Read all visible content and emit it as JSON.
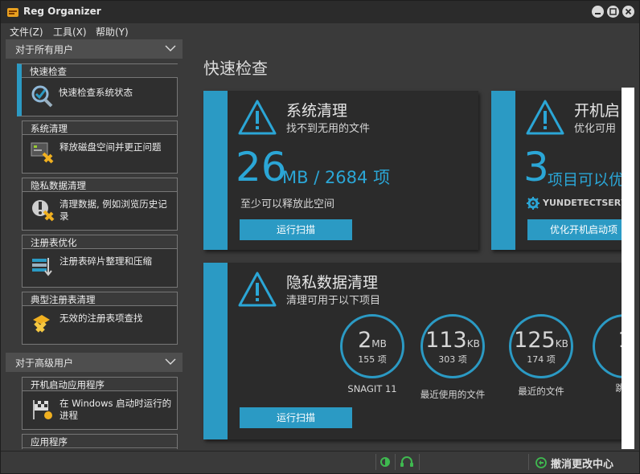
{
  "window": {
    "title": "Reg Organizer"
  },
  "menu": [
    "文件(Z)",
    "工具(X)",
    "帮助(Y)"
  ],
  "sidebar": {
    "section_all_users": "对于所有用户",
    "section_advanced": "对于高级用户",
    "items": [
      {
        "title": "快速检查",
        "desc": "快速检查系统状态",
        "icon": "quick-check-icon",
        "active": true
      },
      {
        "title": "系统清理",
        "desc": "释放磁盘空间并更正问题",
        "icon": "system-cleanup-icon"
      },
      {
        "title": "隐私数据清理",
        "desc": "清理数据, 例如浏览历史记录",
        "icon": "privacy-cleanup-icon"
      },
      {
        "title": "注册表优化",
        "desc": "注册表碎片整理和压缩",
        "icon": "registry-optimize-icon"
      },
      {
        "title": "典型注册表清理",
        "desc": "无效的注册表项查找",
        "icon": "registry-clean-icon"
      },
      {
        "title": "开机启动应用程序",
        "desc": "在 Windows 启动时运行的进程",
        "icon": "startup-apps-icon"
      },
      {
        "title": "应用程序",
        "desc": "",
        "icon": ""
      }
    ]
  },
  "main": {
    "title": "快速检查",
    "system_cleanup": {
      "title": "系统清理",
      "subtitle": "找不到无用的文件",
      "value": "26",
      "unit_text": "MB / 2684 项",
      "note": "至少可以释放此空间",
      "button": "运行扫描"
    },
    "startup": {
      "title": "开机启",
      "subtitle": "优化可用",
      "value": "3",
      "unit_text": "项目可以优",
      "service": "YUNDETECTSERVICE",
      "button": "优化开机启动项"
    },
    "privacy": {
      "title": "隐私数据清理",
      "subtitle": "清理可用于以下项目",
      "button": "运行扫描",
      "circles": [
        {
          "value": "2",
          "unit": "MB",
          "count": "155 项",
          "label": "SNAGIT 11"
        },
        {
          "value": "113",
          "unit": "KB",
          "count": "303 项",
          "label": "最近使用的文件"
        },
        {
          "value": "125",
          "unit": "KB",
          "count": "174 项",
          "label": "最近的文件"
        },
        {
          "value": "1",
          "unit": "",
          "count": "",
          "label": "跳转"
        }
      ]
    }
  },
  "status": {
    "undo_center": "撤消更改中心"
  },
  "colors": {
    "accent": "#2b9ac4",
    "accent_text": "#2ba6d6",
    "panel": "#2b2b2b",
    "background": "#3a3a3a"
  }
}
